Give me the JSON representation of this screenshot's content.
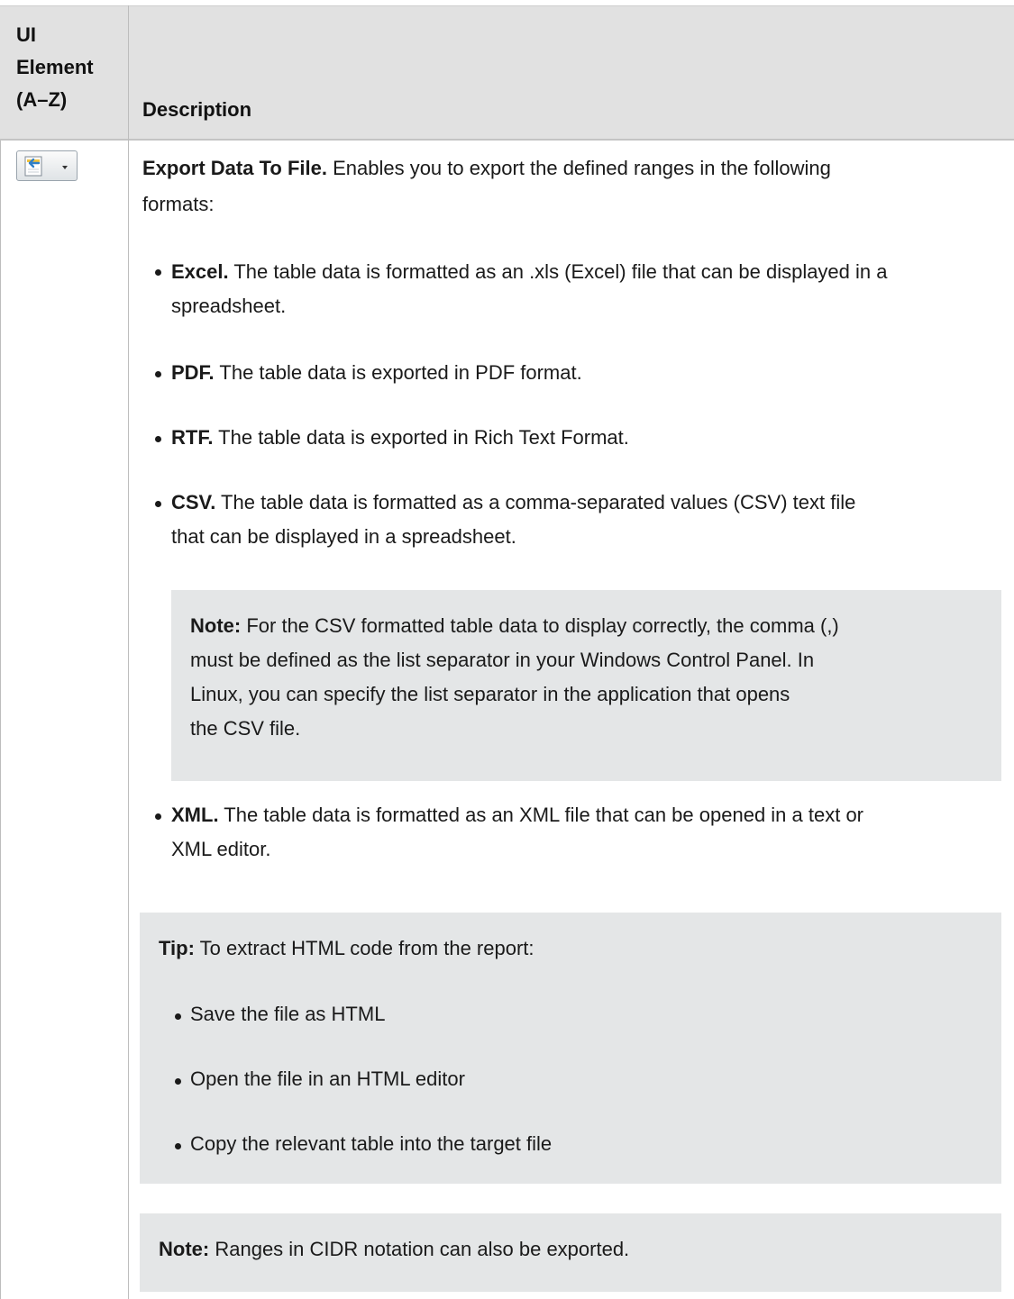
{
  "table": {
    "header": {
      "ui_element_lines": [
        "UI",
        "Element",
        "(A–Z)"
      ],
      "description": "Description"
    },
    "row": {
      "icon": "export-data-to-file-icon",
      "intro": {
        "title": "Export Data To File.",
        "line1": "Enables you to export the defined ranges in the following",
        "line2": "formats:"
      },
      "formats": [
        {
          "name": "Excel.",
          "line1": "The table data is formatted as an .xls (Excel) file that can be displayed in a",
          "line2": "spreadsheet."
        },
        {
          "name": "PDF.",
          "line1": "The table data is exported in PDF format.",
          "line2": ""
        },
        {
          "name": "RTF.",
          "line1": "The table data is exported in Rich Text Format.",
          "line2": ""
        },
        {
          "name": "CSV.",
          "line1": "The table data is formatted as a comma-separated values (CSV) text file",
          "line2": "that can be displayed in a spreadsheet."
        },
        {
          "name": "XML.",
          "line1": "The table data is formatted as an XML file that can be opened in a text or",
          "line2": "XML editor."
        }
      ],
      "csv_note": {
        "label": "Note:",
        "lines": [
          "For the CSV formatted table data to display correctly, the comma (,)",
          "must be defined as the list separator in your Windows Control Panel. In",
          "Linux, you can specify the list separator in the application that opens",
          "the CSV file."
        ]
      },
      "tip": {
        "label": "Tip:",
        "text": "To extract HTML code from the report:",
        "items": [
          "Save the file as HTML",
          "Open the file in an HTML editor",
          "Copy the relevant table into the target file"
        ]
      },
      "cidr_note": {
        "label": "Note:",
        "text": "Ranges in CIDR notation can also be exported."
      }
    }
  },
  "colors": {
    "header_bg": "#e1e1e1",
    "note_bg": "#e4e6e7",
    "text": "#1a1a1a"
  }
}
